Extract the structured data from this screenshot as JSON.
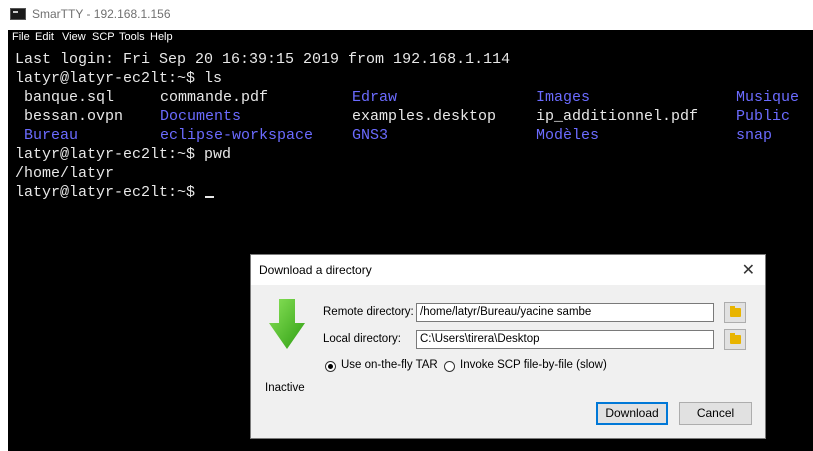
{
  "window": {
    "title": "SmarTTY - 192.168.1.156"
  },
  "menu": [
    "File",
    "Edit",
    "View",
    "SCP",
    "Tools",
    "Help"
  ],
  "terminal": {
    "last_login": "Last login: Fri Sep 20 16:39:15 2019 from 192.168.1.114",
    "prompt_ls": "latyr@latyr-ec2lt:~$ ls",
    "ls_rows": [
      [
        "banque.sql",
        "commande.pdf",
        "Edraw",
        "Images",
        "Musique"
      ],
      [
        "bessan.ovpn",
        "Documents",
        "examples.desktop",
        "ip_additionnel.pdf",
        "Public"
      ],
      [
        "Bureau",
        "eclipse-workspace",
        "GNS3",
        "Modèles",
        "snap"
      ]
    ],
    "prompt_pwd": "latyr@latyr-ec2lt:~$ pwd",
    "pwd_output": "/home/latyr",
    "prompt_current": "latyr@latyr-ec2lt:~$ ",
    "colors": {
      "text": "#e8e8e8",
      "directory": "#6b6bff",
      "background": "#000000"
    }
  },
  "dialog": {
    "title": "Download a directory",
    "close_label": "✕",
    "status": "Inactive",
    "remote_label": "Remote directory:",
    "remote_value": "/home/latyr/Bureau/yacine sambe",
    "local_label": "Local directory:",
    "local_value": "C:\\Users\\tirera\\Desktop",
    "option_tar": "Use on-the-fly TAR",
    "option_scp": "Invoke SCP file-by-file (slow)",
    "selected_option": "Use on-the-fly TAR",
    "download_label": "Download",
    "cancel_label": "Cancel",
    "icon": "download-arrow-icon",
    "accent": "#4cbb17"
  }
}
